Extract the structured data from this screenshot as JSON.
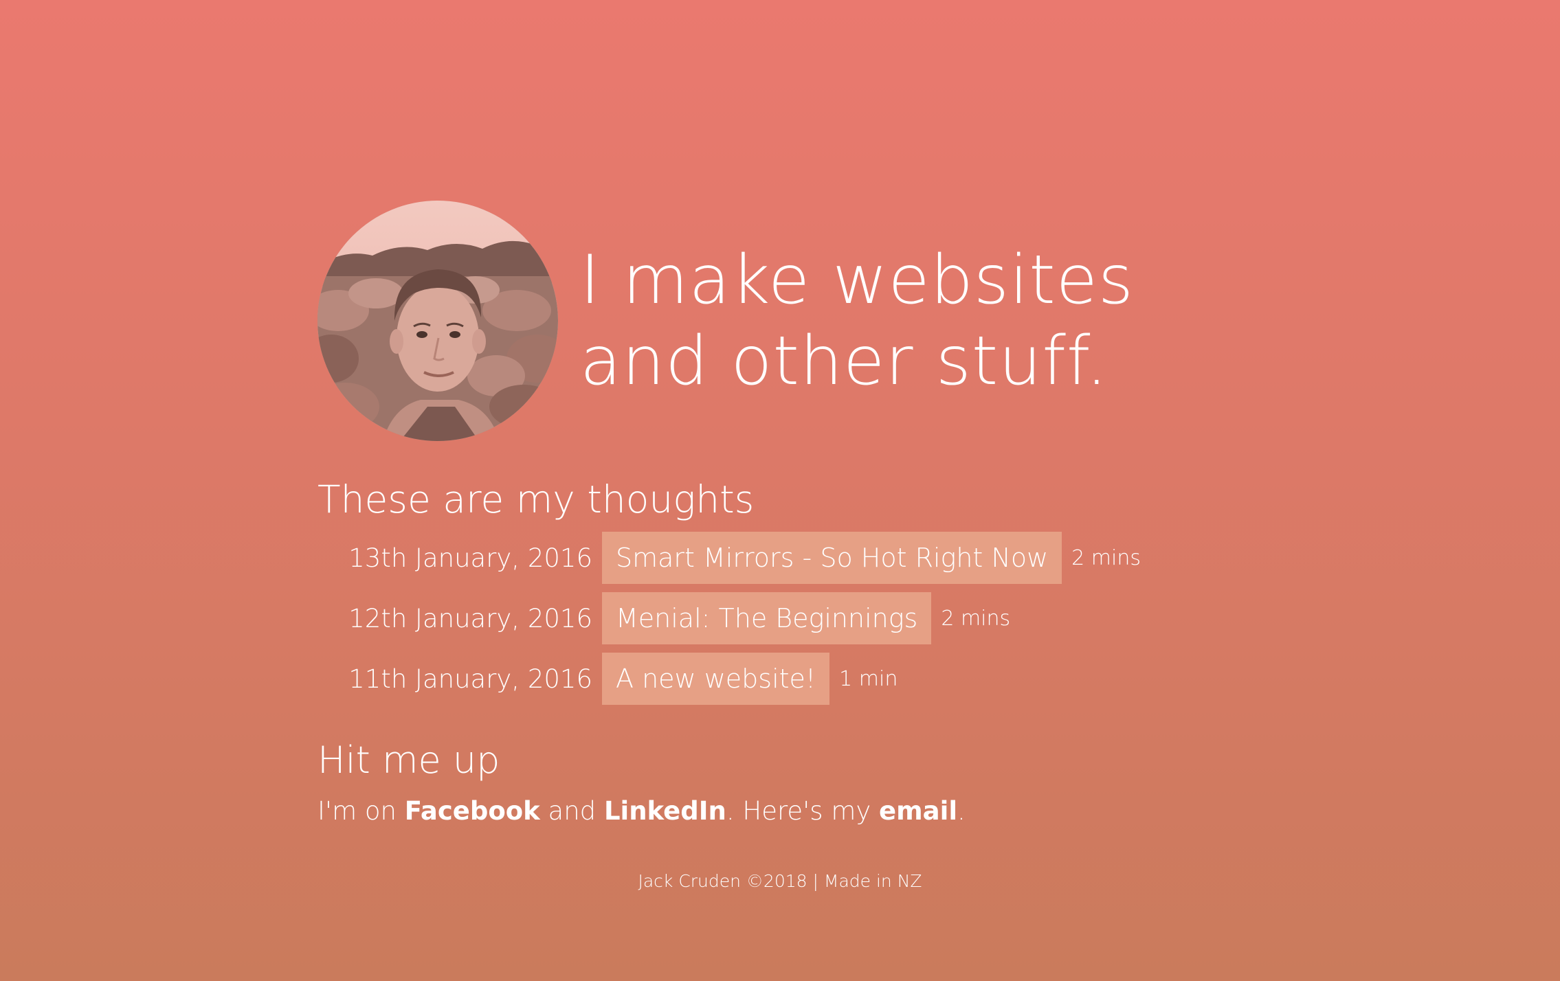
{
  "hero": {
    "avatar_alt": "portrait",
    "tagline": "I make websites and other stuff."
  },
  "thoughts": {
    "title": "These are my thoughts",
    "posts": [
      {
        "date": "13th January, 2016",
        "title": "Smart Mirrors - So Hot Right Now",
        "read_time": "2 mins"
      },
      {
        "date": "12th January, 2016",
        "title": "Menial: The Beginnings",
        "read_time": "2 mins"
      },
      {
        "date": "11th January, 2016",
        "title": "A new website!",
        "read_time": "1 min"
      }
    ]
  },
  "contact": {
    "title": "Hit me up",
    "prefix": "I'm on ",
    "facebook_label": "Facebook",
    "and": " and ",
    "linkedin_label": "LinkedIn",
    "middle": ". Here's my ",
    "email_label": "email",
    "suffix": "."
  },
  "footer": {
    "text": "Jack Cruden ©2018 | Made in NZ"
  },
  "colors": {
    "background_top": "#ea796f",
    "background_bottom": "#ca7b5c",
    "post_highlight": "#e6a085",
    "text": "#ffffff"
  }
}
